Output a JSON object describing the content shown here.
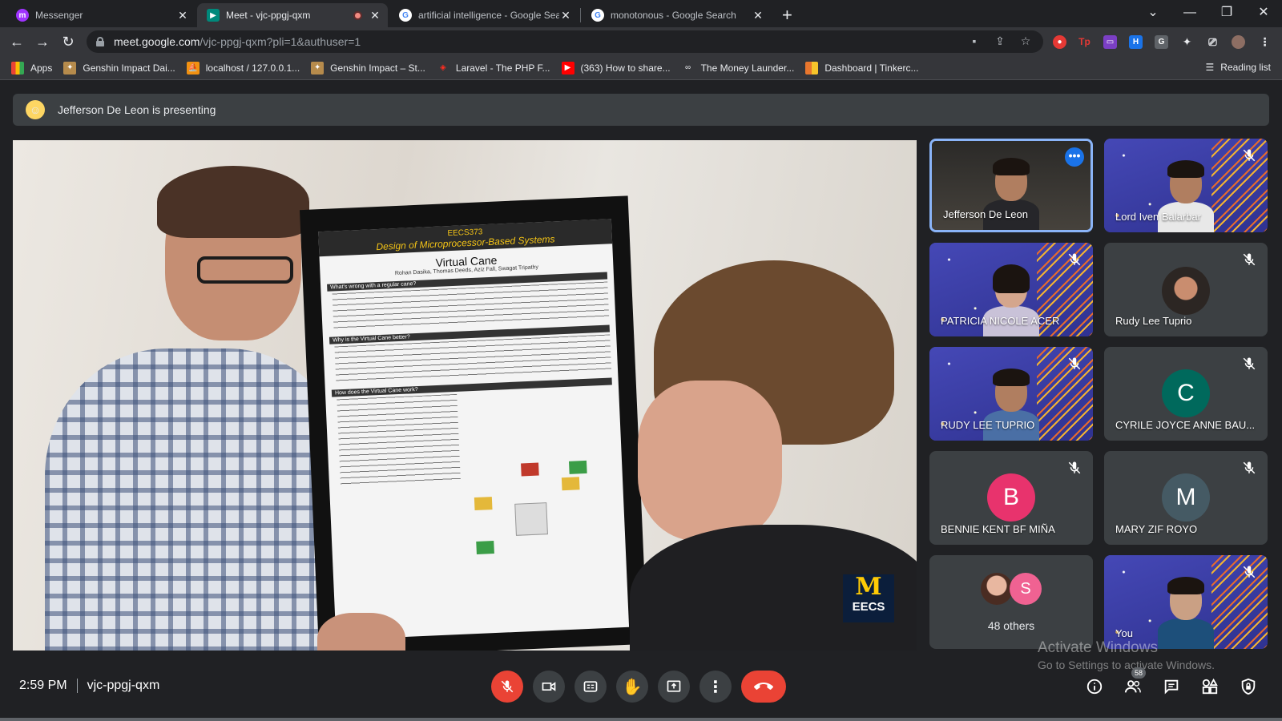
{
  "browser": {
    "tabs": [
      {
        "title": "Messenger",
        "favicon": "messenger-icon",
        "color": "#a033ff"
      },
      {
        "title": "Meet - vjc-ppgj-qxm",
        "favicon": "meet-icon",
        "color": "#00897b",
        "active": true,
        "recording": true
      },
      {
        "title": "artificial intelligence - Google Search",
        "favicon": "google-icon",
        "color": "#4285f4"
      },
      {
        "title": "monotonous - Google Search",
        "favicon": "google-icon",
        "color": "#4285f4"
      }
    ],
    "new_tab": "+",
    "window_controls": {
      "dropdown": "⌄",
      "minimize": "—",
      "restore": "❐",
      "close": "✕"
    },
    "url_host": "meet.google.com",
    "url_path": "/vjc-ppgj-qxm?pli=1&authuser=1",
    "bookmarks": [
      {
        "label": "Apps",
        "icon": "apps-grid-icon",
        "color": "#4285f4"
      },
      {
        "label": "Genshin Impact Dai...",
        "icon": "genshin-icon",
        "color": "#b68b4c"
      },
      {
        "label": "localhost / 127.0.0.1...",
        "icon": "phpmyadmin-icon",
        "color": "#f29111"
      },
      {
        "label": "Genshin Impact – St...",
        "icon": "genshin-icon",
        "color": "#b68b4c"
      },
      {
        "label": "Laravel - The PHP F...",
        "icon": "laravel-icon",
        "color": "#ff2d20"
      },
      {
        "label": "(363) How to share...",
        "icon": "youtube-icon",
        "color": "#ff0000"
      },
      {
        "label": "The Money Launder...",
        "icon": "infinity-icon",
        "color": "#e8eaed"
      },
      {
        "label": "Dashboard | Tinkerc...",
        "icon": "tinkercad-icon",
        "color": "#e8762d"
      }
    ],
    "reading_list": "Reading list"
  },
  "meet": {
    "presenting_banner": "Jefferson De Leon is presenting",
    "presentation": {
      "poster_course": "EECS373",
      "poster_subtitle": "Design of Microprocessor-Based Systems",
      "poster_title": "Virtual Cane",
      "poster_authors": "Rohan Dasika, Thomas Deeds, Aziz Fall, Swagat Tripathy",
      "poster_section_1": "What's wrong with a regular cane?",
      "poster_section_2": "Why is the Virtual Cane better?",
      "poster_section_3": "How does the Virtual Cane work?",
      "logo_letter": "M",
      "logo_text": "EECS"
    },
    "participants": [
      {
        "name": "Jefferson De Leon",
        "type": "video",
        "selected": true,
        "more_options": "•••"
      },
      {
        "name": "Lord Iven Balarbar",
        "type": "video",
        "muted": true
      },
      {
        "name": "PATRICIA NICOLE ACER",
        "type": "video",
        "muted": true
      },
      {
        "name": "Rudy Lee Tuprio",
        "type": "photo",
        "muted": true
      },
      {
        "name": "RUDY LEE TUPRIO",
        "type": "video",
        "muted": true
      },
      {
        "name": "CYRILE JOYCE ANNE BAU...",
        "type": "letter",
        "letter": "C",
        "color": "#00695c",
        "muted": true
      },
      {
        "name": "BENNIE KENT BF MIÑA",
        "type": "letter",
        "letter": "B",
        "color": "#e8336d",
        "muted": true
      },
      {
        "name": "MARY ZIF ROYO",
        "type": "letter",
        "letter": "M",
        "color": "#455a64",
        "muted": true
      },
      {
        "name": "You",
        "type": "video",
        "muted": true
      }
    ],
    "others": {
      "label": "48 others",
      "letter": "S",
      "color": "#f06292"
    },
    "clock": "2:59 PM",
    "meeting_code": "vjc-ppgj-qxm",
    "people_count": "58",
    "watermark_title": "Activate Windows",
    "watermark_sub": "Go to Settings to activate Windows."
  }
}
